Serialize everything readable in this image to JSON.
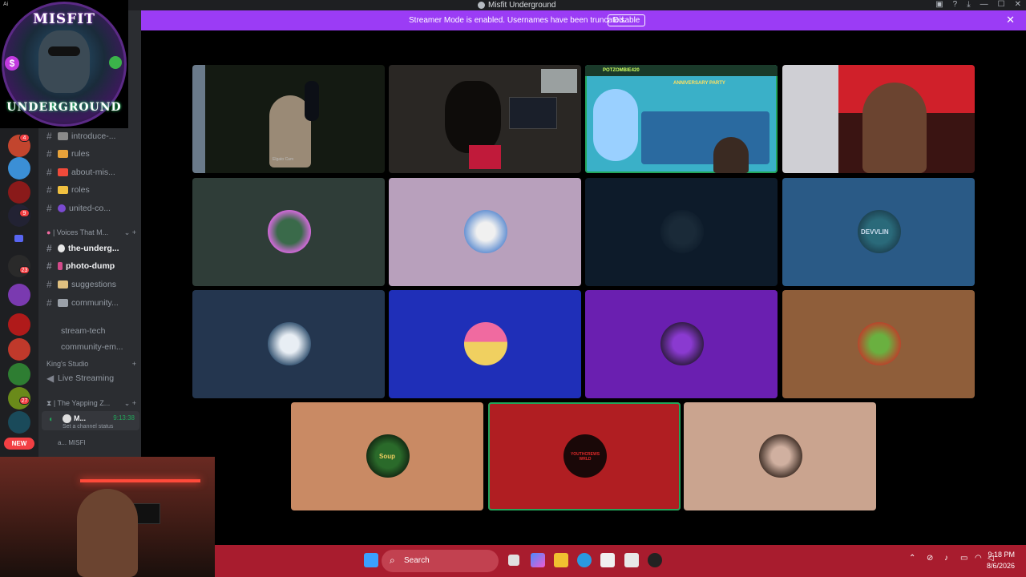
{
  "window": {
    "title": "Misfit Underground"
  },
  "banner": {
    "text": "Streamer Mode is enabled. Usernames have been truncated.",
    "disable_label": "Disable",
    "close_glyph": "✕"
  },
  "logo": {
    "top_text": "MISFIT",
    "bottom_text": "UNDERGROUND",
    "corner_text": "Ai",
    "dollar": "$"
  },
  "rail": {
    "badges": [
      "4",
      "9",
      "23",
      "27"
    ],
    "new_label": "NEW"
  },
  "channels": [
    {
      "name": "introduce-...",
      "emoji_color": "#8a8a8a"
    },
    {
      "name": "rules",
      "emoji_color": "#e8a23a"
    },
    {
      "name": "about-mis...",
      "emoji_color": "#f04a3a"
    },
    {
      "name": "roles",
      "emoji_color": "#f0c040"
    },
    {
      "name": "united-co...",
      "emoji_color": "#7a4ad0"
    }
  ],
  "voices_category": "| Voices That M...",
  "channels2": [
    {
      "name": "the-underg...",
      "unread": true
    },
    {
      "name": "photo-dump",
      "unread": true
    },
    {
      "name": "suggestions",
      "unread": false
    },
    {
      "name": "community...",
      "unread": false
    },
    {
      "name": "stream-tech",
      "unread": false
    },
    {
      "name": "community-em...",
      "unread": false
    }
  ],
  "kings_category": "King's Studio",
  "live_streaming": "Live Streaming",
  "yapping_category": "| The Yapping Z...",
  "voice_user": {
    "name": "M...",
    "time": "9:13:38",
    "status": "Set a channel status"
  },
  "sub_row": "a...   MISFI",
  "tiles": [
    {
      "color": "#2f3d38"
    },
    {
      "color": "#b8a0bc"
    },
    {
      "color": "#0d1b2a"
    },
    {
      "color": "#2a5a86"
    },
    {
      "color": "#24364f"
    },
    {
      "color": "#1f2fb8"
    },
    {
      "color": "#6a1fb0"
    },
    {
      "color": "#8f5e3a"
    },
    {
      "color": "#c98a64"
    },
    {
      "color": "#b01e22"
    },
    {
      "color": "#caa48f"
    }
  ],
  "tile_text": {
    "devvlin": "DEVVLIN",
    "soup": "Soup",
    "youthcrews": "YOUTHCREWS WRLD",
    "potzombie": "POTZOMBIE420",
    "anniversary": "ANNIVERSARY PARTY",
    "cam_label": "Elgato Cam"
  },
  "taskbar": {
    "search_label": "Search",
    "time": "9:18 PM",
    "date": "8/6/2026",
    "accent": "#a81c2e"
  }
}
